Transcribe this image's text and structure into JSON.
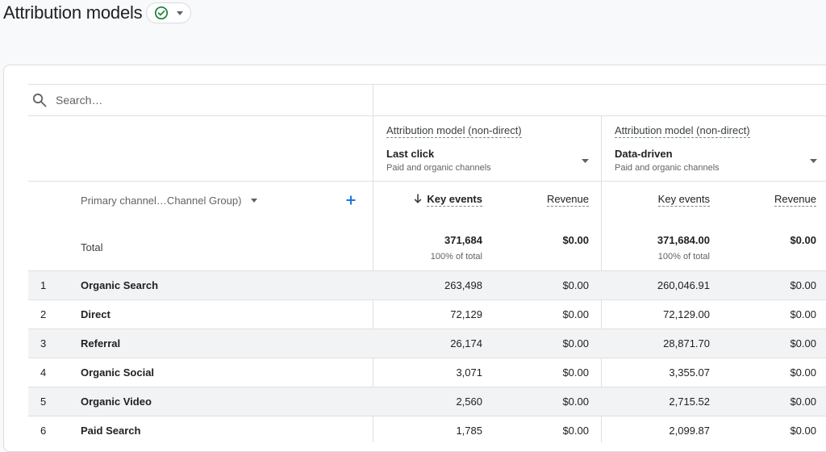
{
  "page": {
    "title": "Attribution models",
    "status_icon": "check-circle-icon",
    "status_color": "#188038"
  },
  "search": {
    "placeholder": "Search…"
  },
  "models": [
    {
      "heading": "Attribution model (non-direct)",
      "name": "Last click",
      "subtitle": "Paid and organic channels"
    },
    {
      "heading": "Attribution model (non-direct)",
      "name": "Data-driven",
      "subtitle": "Paid and organic channels"
    }
  ],
  "columns": {
    "dimension": "Primary channel…Channel Group)",
    "metric1": "Key events",
    "metric2": "Revenue",
    "add_icon_color": "#1a73e8",
    "sort_icon": "arrow-down-icon"
  },
  "totals": {
    "label": "Total",
    "m1_key_events": "371,684",
    "m1_pct": "100% of total",
    "m1_revenue": "$0.00",
    "m2_key_events": "371,684.00",
    "m2_pct": "100% of total",
    "m2_revenue": "$0.00"
  },
  "rows": [
    {
      "index": "1",
      "channel": "Organic Search",
      "m1_key_events": "263,498",
      "m1_revenue": "$0.00",
      "m2_key_events": "260,046.91",
      "m2_revenue": "$0.00"
    },
    {
      "index": "2",
      "channel": "Direct",
      "m1_key_events": "72,129",
      "m1_revenue": "$0.00",
      "m2_key_events": "72,129.00",
      "m2_revenue": "$0.00"
    },
    {
      "index": "3",
      "channel": "Referral",
      "m1_key_events": "26,174",
      "m1_revenue": "$0.00",
      "m2_key_events": "28,871.70",
      "m2_revenue": "$0.00"
    },
    {
      "index": "4",
      "channel": "Organic Social",
      "m1_key_events": "3,071",
      "m1_revenue": "$0.00",
      "m2_key_events": "3,355.07",
      "m2_revenue": "$0.00"
    },
    {
      "index": "5",
      "channel": "Organic Video",
      "m1_key_events": "2,560",
      "m1_revenue": "$0.00",
      "m2_key_events": "2,715.52",
      "m2_revenue": "$0.00"
    },
    {
      "index": "6",
      "channel": "Paid Search",
      "m1_key_events": "1,785",
      "m1_revenue": "$0.00",
      "m2_key_events": "2,099.87",
      "m2_revenue": "$0.00"
    }
  ]
}
